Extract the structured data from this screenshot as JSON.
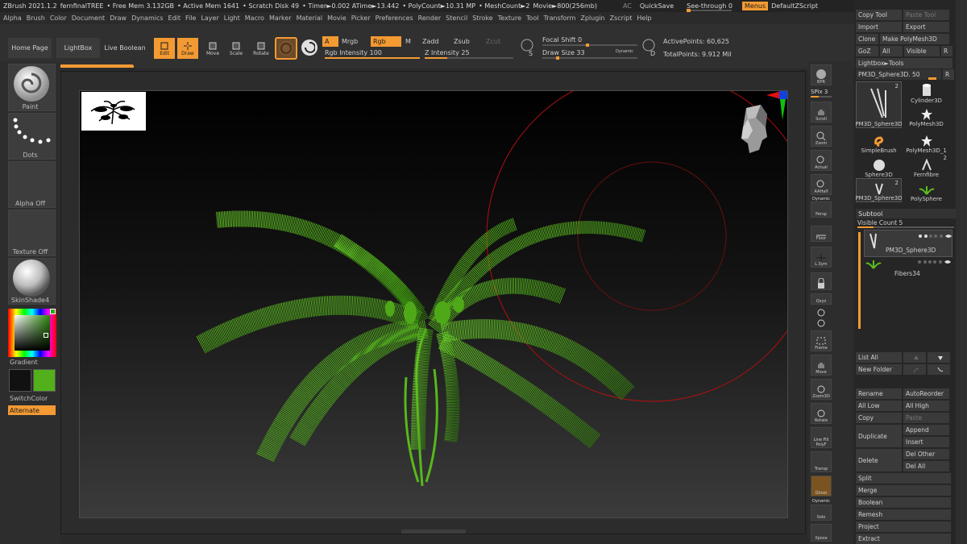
{
  "title": {
    "app": "ZBrush 2021.1.2",
    "doc": "fernfinalTREE",
    "free_mem": "• Free Mem 3.132GB",
    "active_mem": "• Active Mem 1641",
    "scratch": "• Scratch Disk 49",
    "timer": "• Timer►0.002 ATime►13.442",
    "polycount": "• PolyCount►10.31 MP",
    "meshcount": "• MeshCount►2",
    "movie": "Movie►800(256mb)",
    "ac": "AC",
    "quicksave": "QuickSave",
    "see_through": "See-through  0",
    "menus": "Menus",
    "defaultzscript": "DefaultZScript"
  },
  "menu": [
    "Alpha",
    "Brush",
    "Color",
    "Document",
    "Draw",
    "Dynamics",
    "Edit",
    "File",
    "Layer",
    "Light",
    "Macro",
    "Marker",
    "Material",
    "Movie",
    "Picker",
    "Preferences",
    "Render",
    "Stencil",
    "Stroke",
    "Texture",
    "Tool",
    "Transform",
    "Zplugin",
    "Zscript",
    "Help"
  ],
  "shelf": {
    "home": "Home Page",
    "lightbox": "LightBox",
    "liveboolean": "Live Boolean",
    "edit": "Edit",
    "draw": "Draw",
    "move": "Move",
    "scale": "Scale",
    "rotate": "Rotate",
    "a": "A",
    "mrgb": "Mrgb",
    "rgb": "Rgb",
    "m": "M",
    "zadd": "Zadd",
    "zsub": "Zsub",
    "zcut": "Zcut",
    "rgb_intensity": "Rgb Intensity 100",
    "rgb_intensity_level": 1.0,
    "z_intensity": "Z Intensity 25",
    "z_intensity_level": 0.25,
    "focal_shift": "Focal Shift 0",
    "draw_size": "Draw Size 33",
    "dynamic": "Dynamic",
    "s": "S",
    "d": "D",
    "active_points": "ActivePoints: 60,625",
    "total_points": "TotalPoints: 9.912 Mil"
  },
  "left": {
    "paint": "Paint",
    "dots": "Dots",
    "alpha_off": "Alpha Off",
    "texture_off": "Texture Off",
    "skinshade": "SkinShade4",
    "gradient": "Gradient",
    "switchcolor": "SwitchColor",
    "alternate": "Alternate"
  },
  "right": {
    "bpr": "BPR",
    "spix": "SPix 3",
    "scroll": "Scroll",
    "zoom": "Zoom",
    "actual": "Actual",
    "aahalf": "AAHalf",
    "dynamic": "Dynamic",
    "persp": "Persp",
    "floor": "Floor",
    "lsym": "L.Sym",
    "qxyz": "Qxyz",
    "frame": "Frame",
    "move": "Move",
    "zoom3d": "Zoom3D",
    "rotate": "Rotate",
    "linefill": "Line Fill",
    "polyf": "PolyF",
    "transp": "Transp",
    "ghost": "Ghost",
    "solo_dynamic": "Dynamic",
    "solo": "Solo",
    "xpose": "Xpose"
  },
  "tray": {
    "copy_tool": "Copy Tool",
    "paste_tool": "Paste Tool",
    "import": "Import",
    "export": "Export",
    "clone": "Clone",
    "make_polymesh": "Make PolyMesh3D",
    "goz": "GoZ",
    "all": "All",
    "visible": "Visible",
    "r": "R",
    "lightbox_tools": "Lightbox►Tools",
    "pm3d_sphere": "PM3D_Sphere3D. 50",
    "r2": "R",
    "tools": [
      {
        "name": "PM3D_Sphere3D",
        "badge": "2"
      },
      {
        "name": "Cylinder3D",
        "badge": ""
      },
      {
        "name": "PolyMesh3D",
        "badge": ""
      },
      {
        "name": "SimpleBrush",
        "badge": ""
      },
      {
        "name": "PolyMesh3D_1",
        "badge": ""
      },
      {
        "name": "Sphere3D",
        "badge": ""
      },
      {
        "name": "Fernfibre",
        "badge": "2"
      },
      {
        "name": "PM3D_Sphere3D",
        "badge": "2"
      },
      {
        "name": "PolySphere",
        "badge": ""
      }
    ],
    "subtool": "Subtool",
    "visible_count": "Visible Count 5",
    "subtool1": "PM3D_Sphere3D",
    "subtool2": "Fibers34",
    "list_all": "List All",
    "new_folder": "New Folder",
    "rename": "Rename",
    "autoreorder": "AutoReorder",
    "all_low": "All Low",
    "all_high": "All High",
    "copy": "Copy",
    "paste": "Paste",
    "duplicate": "Duplicate",
    "append": "Append",
    "insert": "Insert",
    "delete": "Delete",
    "del_other": "Del Other",
    "del_all": "Del All",
    "split": "Split",
    "merge": "Merge",
    "boolean": "Boolean",
    "remesh": "Remesh",
    "project": "Project",
    "extract": "Extract"
  },
  "colors": {
    "accent": "#f39a33",
    "fern": "#4fb51b",
    "primary_color": "#52b01a"
  }
}
